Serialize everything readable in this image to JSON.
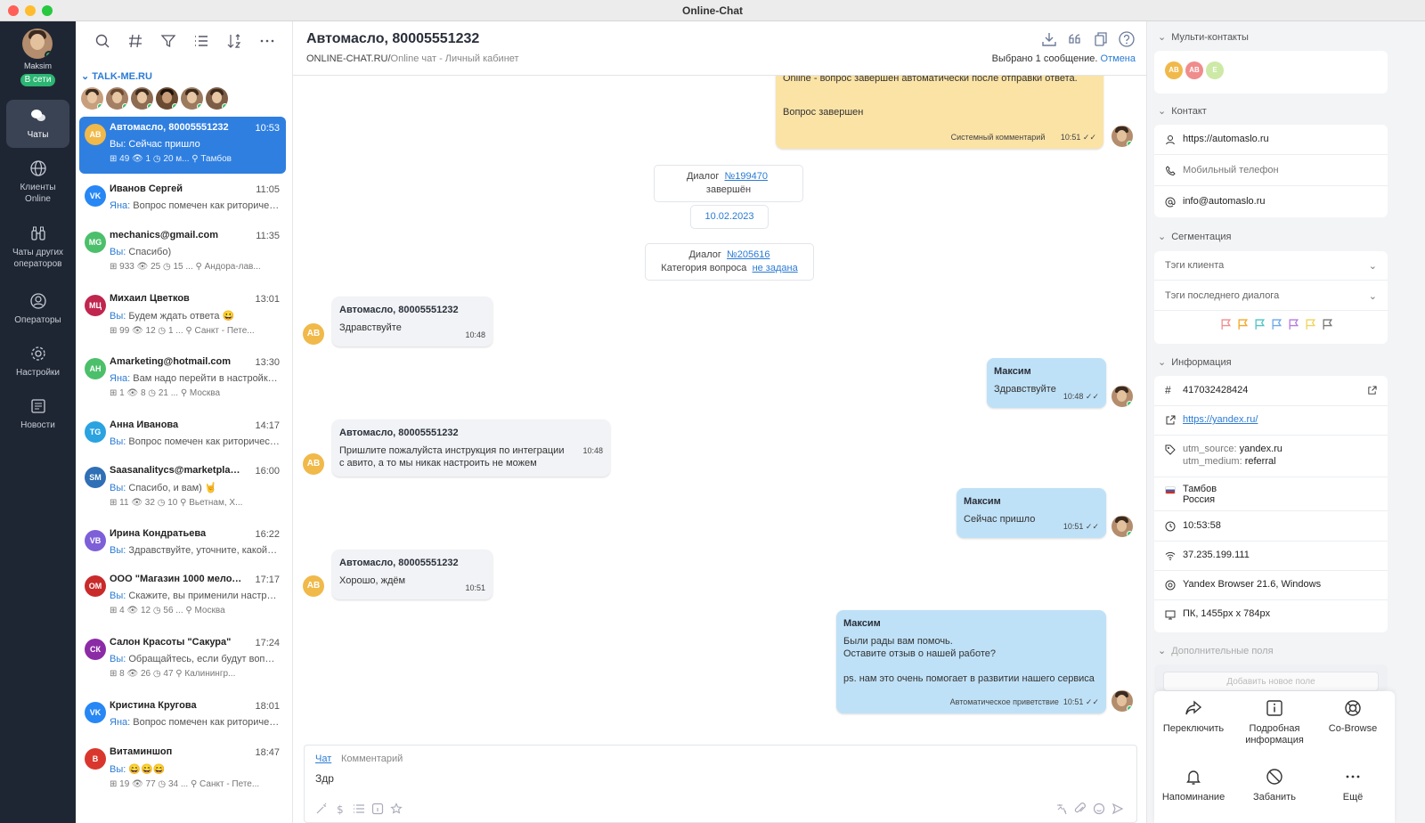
{
  "window": {
    "title": "Online-Chat"
  },
  "nav": {
    "user_name": "Maksim",
    "status": "В сети",
    "items": [
      {
        "label": "Чаты",
        "icon": "chat-icon"
      },
      {
        "label": "Клиенты Online",
        "icon": "globe-icon"
      },
      {
        "label": "Чаты других операторов",
        "icon": "binoculars-icon"
      },
      {
        "label": "Операторы",
        "icon": "operator-icon"
      },
      {
        "label": "Настройки",
        "icon": "gear-icon"
      },
      {
        "label": "Новости",
        "icon": "news-icon"
      }
    ]
  },
  "list": {
    "group": "TALK-ME.RU",
    "chats": [
      {
        "initials": "АВ",
        "color": "#f0b94a",
        "name": "Автомасло, 80005551232",
        "time": "10:53",
        "who": "Вы:",
        "msg": "Сейчас пришло",
        "meta": "⊞ 49    👁 1    ◷ 20 м...  ⚲ Тамбов",
        "active": true
      },
      {
        "initials": "VK",
        "color": "#2787f5",
        "name": "Иванов Сергей",
        "time": "11:05",
        "who": "Яна:",
        "msg": "Вопрос помечен как риторический",
        "meta": ""
      },
      {
        "initials": "MG",
        "color": "#4cbf6a",
        "name": "mechanics@gmail.com",
        "time": "11:35",
        "who": "Вы:",
        "msg": "Спасибо)",
        "meta": "⊞ 933   👁 25   ◷ 15 ...  ⚲ Андора-лав..."
      },
      {
        "initials": "МЦ",
        "color": "#c0264e",
        "name": "Михаил Цветков",
        "time": "13:01",
        "who": "Вы:",
        "msg": "Будем ждать ответа 😀",
        "meta": "⊞ 99    👁 12   ◷ 1 ...   ⚲ Санкт - Пете..."
      },
      {
        "initials": "AH",
        "color": "#4cbf6a",
        "name": "Amarketing@hotmail.com",
        "time": "13:30",
        "who": "Яна:",
        "msg": "Вам надо перейти в настройки и...",
        "meta": "⊞ 1     👁 8    ◷ 21 ...  ⚲ Москва"
      },
      {
        "initials": "TG",
        "color": "#2aa3e0",
        "name": "Анна Иванова",
        "time": "14:17",
        "who": "Вы:",
        "msg": "Вопрос помечен как риторический",
        "meta": ""
      },
      {
        "initials": "SM",
        "color": "#2f6fb5",
        "name": "Saasanalitycs@marketplace.ru",
        "time": "16:00",
        "who": "Вы:",
        "msg": "Спасибо, и вам) 🤘",
        "meta": "⊞ 11    👁 32   ◷ 10    ⚲ Вьетнам, Х..."
      },
      {
        "initials": "VB",
        "color": "#7d5fd8",
        "name": "Ирина Кондратьева",
        "time": "16:22",
        "who": "Вы:",
        "msg": "Здравствуйте, уточните, какой у в...",
        "meta": ""
      },
      {
        "initials": "ОМ",
        "color": "#c92a2a",
        "name": "ООО \"Магазин 1000 мелочей\"",
        "time": "17:17",
        "who": "Вы:",
        "msg": "Скажите, вы применили настройки?",
        "meta": "⊞ 4     👁 12   ◷ 56 ...  ⚲ Москва"
      },
      {
        "initials": "СК",
        "color": "#8b2ca6",
        "name": "Салон Красоты \"Сакура\"",
        "time": "17:24",
        "who": "Вы:",
        "msg": "Обращайтесь, если будут вопросы)",
        "meta": "⊞ 8     👁 26   ◷ 47    ⚲ Калинингр..."
      },
      {
        "initials": "VK",
        "color": "#2787f5",
        "name": "Кристина Кругова",
        "time": "18:01",
        "who": "Яна:",
        "msg": "Вопрос помечен как риторический",
        "meta": ""
      },
      {
        "initials": "В",
        "color": "#d9372d",
        "name": "Витаминшоп",
        "time": "18:47",
        "who": "Вы:",
        "msg": "😄😄😄",
        "meta": "⊞ 19    👁 77   ◷ 34 ...  ⚲ Санкт - Пете..."
      }
    ]
  },
  "main": {
    "title": "Автомасло, 80005551232",
    "sub_site": "ONLINE-CHAT.RU/",
    "sub_page": "Online чат - Личный кабинет",
    "selected": "Выбрано 1 сообщение.",
    "cancel": "Отмена",
    "sys_text_top": "Online - вопрос завершен автоматически после отправки ответа.",
    "sys_text": "Вопрос завершен",
    "sys_label": "Системный комментарий",
    "sys_time": "10:51",
    "dialog1_prefix": "Диалог",
    "dialog1_link": "№199470",
    "dialog1_suffix": "завершён",
    "date": "10.02.2023",
    "dialog2_prefix": "Диалог",
    "dialog2_link": "№205616",
    "category_label": "Категория вопроса",
    "category_link": "не задана",
    "messages": [
      {
        "author": "Автомасло, 80005551232",
        "text": "Здравствуйте",
        "time": "10:48"
      },
      {
        "author": "Максим",
        "text": "Здравствуйте",
        "time": "10:48 ✓✓"
      },
      {
        "author": "Автомасло, 80005551232",
        "text": "Пришлите пожалуйста инструкция по интеграции\nс авито, а то мы никак настроить не можем",
        "time": "10:48"
      },
      {
        "author": "Максим",
        "text": "Сейчас пришло",
        "time": "10:51 ✓✓"
      },
      {
        "author": "Автомасло, 80005551232",
        "text": "Хорошо, ждём",
        "time": "10:51"
      },
      {
        "author": "Максим",
        "text": "Были рады вам помочь.\nОставите отзыв о нашей работе?\n\nps. нам это очень помогает в развитии нашего сервиса",
        "time": "10:51 ✓✓",
        "label": "Автоматическое приветствие"
      }
    ],
    "composer": {
      "tab_chat": "Чат",
      "tab_comment": "Комментарий",
      "value": "Здр"
    }
  },
  "right": {
    "multi_title": "Мульти-контакты",
    "multi": [
      {
        "i": "АВ",
        "c": "#f0b94a"
      },
      {
        "i": "АВ",
        "c": "#f08c8c"
      },
      {
        "i": "E",
        "c": "#cde9a6"
      }
    ],
    "contact_title": "Контакт",
    "contact_site": "https://automaslo.ru",
    "contact_phone": "Мобильный телефон",
    "contact_email": "info@automaslo.ru",
    "seg_title": "Сегментация",
    "seg_client_tags": "Тэги клиента",
    "seg_dialog_tags": "Тэги последнего диалога",
    "info_title": "Информация",
    "info_id": "417032428424",
    "info_url": "https://yandex.ru/",
    "utm_source_label": "utm_source:",
    "utm_source": "yandex.ru",
    "utm_medium_label": "utm_medium:",
    "utm_medium": "referral",
    "city": "Тамбов",
    "country": "Россия",
    "time": "10:53:58",
    "ip": "37.235.199.111",
    "browser": "Yandex Browser 21.6, Windows",
    "device": "ПК, 1455px x 784px",
    "extra_title": "Дополнительные поля",
    "add_field": "Добавить новое поле",
    "actions": [
      "Переключить",
      "Подробная информация",
      "Co-Browse",
      "Напоминание",
      "Забанить",
      "Ещё"
    ]
  }
}
